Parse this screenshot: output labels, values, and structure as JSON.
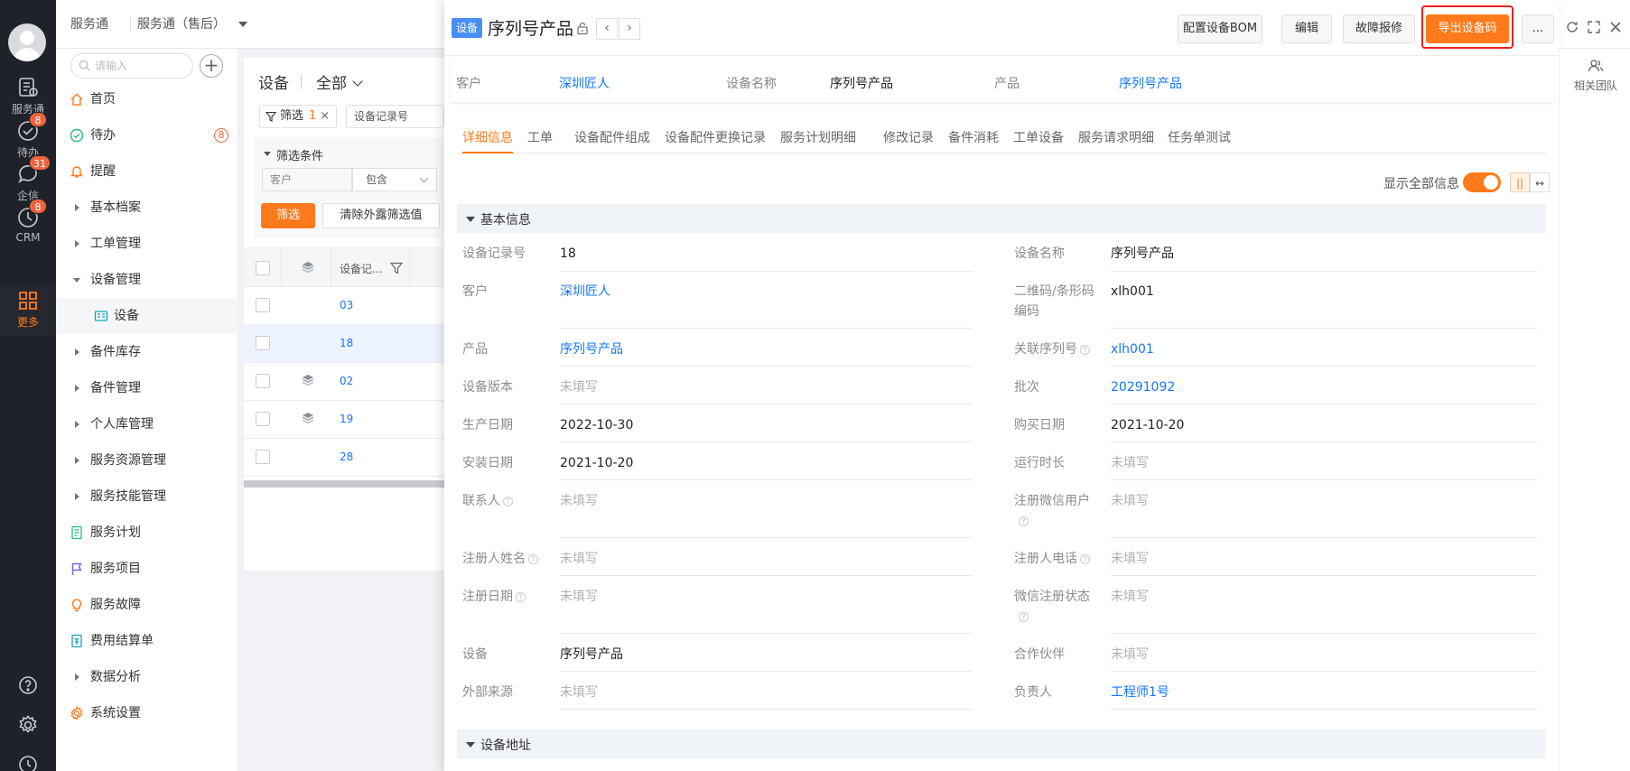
{
  "rail": {
    "items": [
      {
        "label": "服务通",
        "badge": ""
      },
      {
        "label": "待办",
        "badge": "8"
      },
      {
        "label": "企信",
        "badge": "31"
      },
      {
        "label": "CRM",
        "badge": "8"
      },
      {
        "label": "更多",
        "badge": ""
      }
    ]
  },
  "topbar": {
    "app": "服务通",
    "select": "服务通（售后）"
  },
  "sidenav": {
    "search_placeholder": "请输入",
    "items": [
      {
        "label": "首页"
      },
      {
        "label": "待办",
        "badge": "8"
      },
      {
        "label": "提醒"
      },
      {
        "label": "基本档案"
      },
      {
        "label": "工单管理"
      },
      {
        "label": "设备管理"
      },
      {
        "label": "设备"
      },
      {
        "label": "备件库存"
      },
      {
        "label": "备件管理"
      },
      {
        "label": "个人库管理"
      },
      {
        "label": "服务资源管理"
      },
      {
        "label": "服务技能管理"
      },
      {
        "label": "服务计划"
      },
      {
        "label": "服务项目"
      },
      {
        "label": "服务故障"
      },
      {
        "label": "费用结算单"
      },
      {
        "label": "数据分析"
      },
      {
        "label": "系统设置"
      }
    ]
  },
  "list": {
    "title": "设备",
    "scope": "全部",
    "filter_chip": {
      "label": "筛选",
      "count": "1",
      "close": "×"
    },
    "field_select": "设备记录号",
    "conditions_title": "筛选条件",
    "cond_field": "客户",
    "cond_op": "包含",
    "filter_btn": "筛选",
    "clear_btn": "清除外露筛选值",
    "col_header": "设备记...",
    "rows": [
      {
        "rec": "03",
        "pkg": false
      },
      {
        "rec": "18",
        "pkg": false
      },
      {
        "rec": "02",
        "pkg": true
      },
      {
        "rec": "19",
        "pkg": true
      },
      {
        "rec": "28",
        "pkg": false
      }
    ]
  },
  "detail": {
    "tag": "设备",
    "title": "序列号产品",
    "prev": "‹",
    "next": "›",
    "buttons": {
      "bom": "配置设备BOM",
      "edit": "编辑",
      "repair": "故障报修",
      "export": "导出设备码",
      "more": "..."
    },
    "summary": {
      "customer_label": "客户",
      "customer_value": "深圳匠人",
      "device_name_label": "设备名称",
      "device_name_value": "序列号产品",
      "product_label": "产品",
      "product_value": "序列号产品"
    },
    "tabs": [
      "详细信息",
      "工单",
      "设备配件组成",
      "设备配件更换记录",
      "服务计划明细",
      "修改记录",
      "备件消耗",
      "工单设备",
      "服务请求明细",
      "任务单测试"
    ],
    "show_all_label": "显示全部信息",
    "layout_btn_a": "||",
    "layout_btn_b": "↔",
    "section_basic": "基本信息",
    "section_address": "设备地址",
    "help_mark": "?",
    "fields": {
      "rec_label": "设备记录号",
      "rec_value": "18",
      "name_label": "设备名称",
      "name_value": "序列号产品",
      "cust_label": "客户",
      "cust_value": "深圳匠人",
      "qr_label_1": "二维码/条形码",
      "qr_label_2": "编码",
      "qr_value": "xlh001",
      "prod_label": "产品",
      "prod_value": "序列号产品",
      "serial_label": "关联序列号",
      "serial_value": "xlh001",
      "ver_label": "设备版本",
      "ver_value": "未填写",
      "batch_label": "批次",
      "batch_value": "20291092",
      "mfg_label": "生产日期",
      "mfg_value": "2022-10-30",
      "buy_label": "购买日期",
      "buy_value": "2021-10-20",
      "install_label": "安装日期",
      "install_value": "2021-10-20",
      "runtime_label": "运行时长",
      "runtime_value": "未填写",
      "contact_label": "联系人",
      "contact_value": "未填写",
      "wx_user_label": "注册微信用户",
      "wx_user_value": "未填写",
      "reg_name_label": "注册人姓名",
      "reg_name_value": "未填写",
      "reg_phone_label": "注册人电话",
      "reg_phone_value": "未填写",
      "reg_date_label": "注册日期",
      "reg_date_value": "未填写",
      "wx_status_label": "微信注册状态",
      "wx_status_value": "未填写",
      "device_label": "设备",
      "device_value": "序列号产品",
      "partner_label": "合作伙伴",
      "partner_value": "未填写",
      "source_label": "外部来源",
      "source_value": "未填写",
      "owner_label": "负责人",
      "owner_value": "工程师1号"
    }
  },
  "rightcol": {
    "team": "相关团队"
  },
  "colors": {
    "accent": "#ff7a1a",
    "link": "#1677ff",
    "rail": "#1f2329",
    "highlight_ring": "#e8231f"
  }
}
